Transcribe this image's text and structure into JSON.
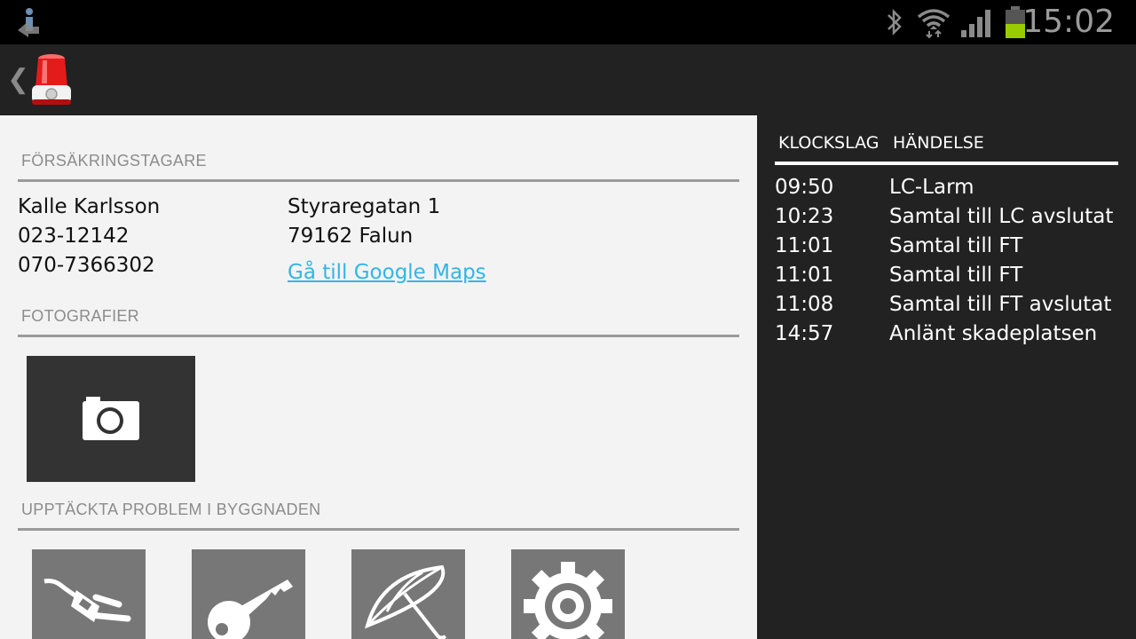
{
  "status_bar": {
    "time": "15:02",
    "icons": [
      "notification-icon",
      "bluetooth-icon",
      "wifi-icon",
      "signal-icon",
      "battery-icon"
    ],
    "battery_color": "#99cc00"
  },
  "action_bar": {
    "back_glyph": "❮",
    "app_icon": "siren-icon",
    "accent": "#e31b1b"
  },
  "insured": {
    "section_title": "FÖRSÄKRINGSTAGARE",
    "name": "Kalle Karlsson",
    "phone1": "023-12142",
    "phone2": "070-7366302",
    "street": "Styraregatan 1",
    "city": "79162 Falun",
    "maps_link": "Gå till Google Maps",
    "link_color": "#33b5e5"
  },
  "photos": {
    "section_title": "FOTOGRAFIER",
    "add_icon": "camera-icon"
  },
  "problems": {
    "section_title": "UPPTÄCKTA PROBLEM I BYGGNADEN",
    "tiles": [
      {
        "icon": "plug-icon"
      },
      {
        "icon": "key-icon"
      },
      {
        "icon": "umbrella-icon"
      },
      {
        "icon": "gear-icon"
      }
    ]
  },
  "timeline": {
    "col_time": "KLOCKSLAG",
    "col_event": "HÄNDELSE",
    "rows": [
      {
        "time": "09:50",
        "event": "LC-Larm"
      },
      {
        "time": "10:23",
        "event": "Samtal till LC avslutat"
      },
      {
        "time": "11:01",
        "event": "Samtal till FT"
      },
      {
        "time": "11:01",
        "event": "Samtal till FT"
      },
      {
        "time": "11:08",
        "event": "Samtal till FT avslutat"
      },
      {
        "time": "14:57",
        "event": "Anlänt skadeplatsen"
      }
    ]
  }
}
